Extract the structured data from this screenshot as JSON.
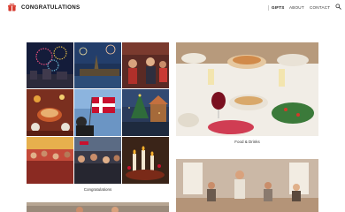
{
  "header": {
    "brand": "CONGRATULATIONS",
    "nav": [
      {
        "label": "GIFTS",
        "active": true
      },
      {
        "label": "ABOUT",
        "active": false
      },
      {
        "label": "CONTACT",
        "active": false
      }
    ],
    "search_icon": "search-icon",
    "logo_icon": "gift-box-icon",
    "brand_color": "#d63a2f"
  },
  "gallery": {
    "items": [
      {
        "caption": "Congratulations"
      },
      {
        "caption": "Food & Drinks"
      }
    ]
  }
}
